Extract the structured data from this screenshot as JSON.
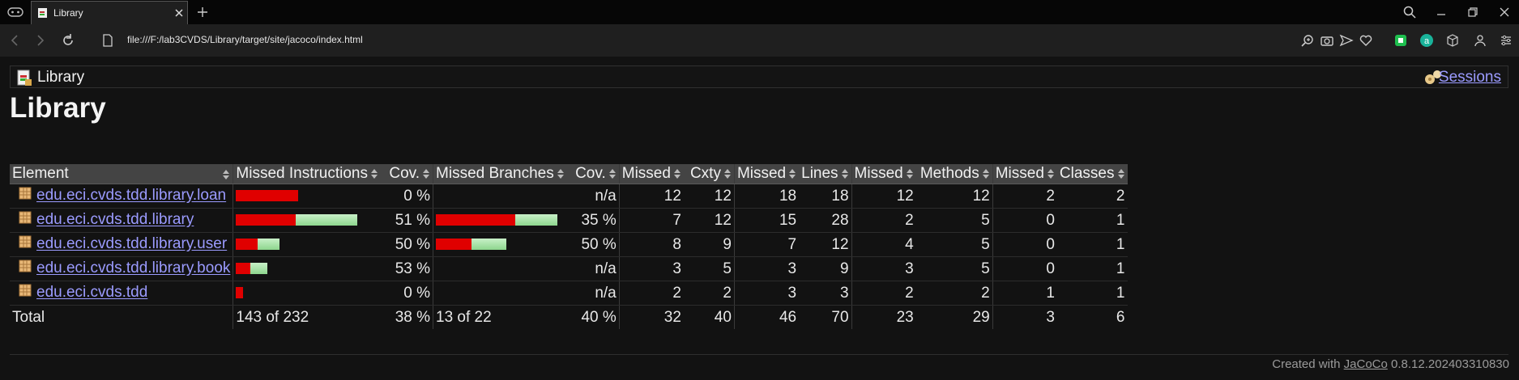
{
  "browser": {
    "tab_title": "Library",
    "url": "file:///F:/lab3CVDS/Library/target/site/jacoco/index.html"
  },
  "page": {
    "breadcrumb": "Library",
    "sessions_label": "Sessions",
    "title": "Library"
  },
  "table": {
    "headers": [
      "Element",
      "Missed Instructions",
      "Cov.",
      "Missed Branches",
      "Cov.",
      "Missed",
      "Cxty",
      "Missed",
      "Lines",
      "Missed",
      "Methods",
      "Missed",
      "Classes"
    ],
    "rows": [
      {
        "name": "edu.eci.cvds.tdd.library.loan",
        "instr_missed_fraction": 1.0,
        "instr_cov": "0 %",
        "branch_cov": "n/a",
        "branch_missed_fraction": null,
        "cxty_missed": "12",
        "cxty": "12",
        "lines_missed": "18",
        "lines": "18",
        "methods_missed": "12",
        "methods": "12",
        "classes_missed": "2",
        "classes": "2",
        "instr_total_rel": 0.51,
        "branch_total_rel": null
      },
      {
        "name": "edu.eci.cvds.tdd.library",
        "instr_missed_fraction": 0.49,
        "instr_cov": "51 %",
        "branch_cov": "35 %",
        "branch_missed_fraction": 0.65,
        "cxty_missed": "7",
        "cxty": "12",
        "lines_missed": "15",
        "lines": "28",
        "methods_missed": "2",
        "methods": "5",
        "classes_missed": "0",
        "classes": "1",
        "instr_total_rel": 1.0,
        "branch_total_rel": 1.0
      },
      {
        "name": "edu.eci.cvds.tdd.library.user",
        "instr_missed_fraction": 0.5,
        "instr_cov": "50 %",
        "branch_cov": "50 %",
        "branch_missed_fraction": 0.5,
        "cxty_missed": "8",
        "cxty": "9",
        "lines_missed": "7",
        "lines": "12",
        "methods_missed": "4",
        "methods": "5",
        "classes_missed": "0",
        "classes": "1",
        "instr_total_rel": 0.36,
        "branch_total_rel": 0.58
      },
      {
        "name": "edu.eci.cvds.tdd.library.book",
        "instr_missed_fraction": 0.47,
        "instr_cov": "53 %",
        "branch_cov": "n/a",
        "branch_missed_fraction": null,
        "cxty_missed": "3",
        "cxty": "5",
        "lines_missed": "3",
        "lines": "9",
        "methods_missed": "3",
        "methods": "5",
        "classes_missed": "0",
        "classes": "1",
        "instr_total_rel": 0.26,
        "branch_total_rel": null
      },
      {
        "name": "edu.eci.cvds.tdd",
        "instr_missed_fraction": 1.0,
        "instr_cov": "0 %",
        "branch_cov": "n/a",
        "branch_missed_fraction": null,
        "cxty_missed": "2",
        "cxty": "2",
        "lines_missed": "3",
        "lines": "3",
        "methods_missed": "2",
        "methods": "2",
        "classes_missed": "1",
        "classes": "1",
        "instr_total_rel": 0.06,
        "branch_total_rel": null
      }
    ],
    "total": {
      "label": "Total",
      "instr": "143 of 232",
      "instr_cov": "38 %",
      "branch": "13 of 22",
      "branch_cov": "40 %",
      "cxty_missed": "32",
      "cxty": "40",
      "lines_missed": "46",
      "lines": "70",
      "methods_missed": "23",
      "methods": "29",
      "classes_missed": "3",
      "classes": "6"
    }
  },
  "footer": {
    "prefix": "Created with",
    "link": "JaCoCo",
    "version": "0.8.12.202403310830"
  },
  "colors": {
    "missed_bar": "#e00000",
    "covered_bar": "#8ed68e",
    "link": "#9b9bff",
    "background": "#121212"
  },
  "icons": [
    "gamepad-icon",
    "favicon-icon",
    "close-icon",
    "plus-icon",
    "search-icon",
    "minimize-icon",
    "restore-icon",
    "close-window-icon",
    "back-icon",
    "forward-icon",
    "reload-icon",
    "file-icon",
    "zoom-icon",
    "camera-icon",
    "send-icon",
    "heart-icon",
    "extension-icon",
    "account-icon",
    "settings-icon",
    "report-icon",
    "sessions-icon",
    "package-icon",
    "sort-icon"
  ]
}
